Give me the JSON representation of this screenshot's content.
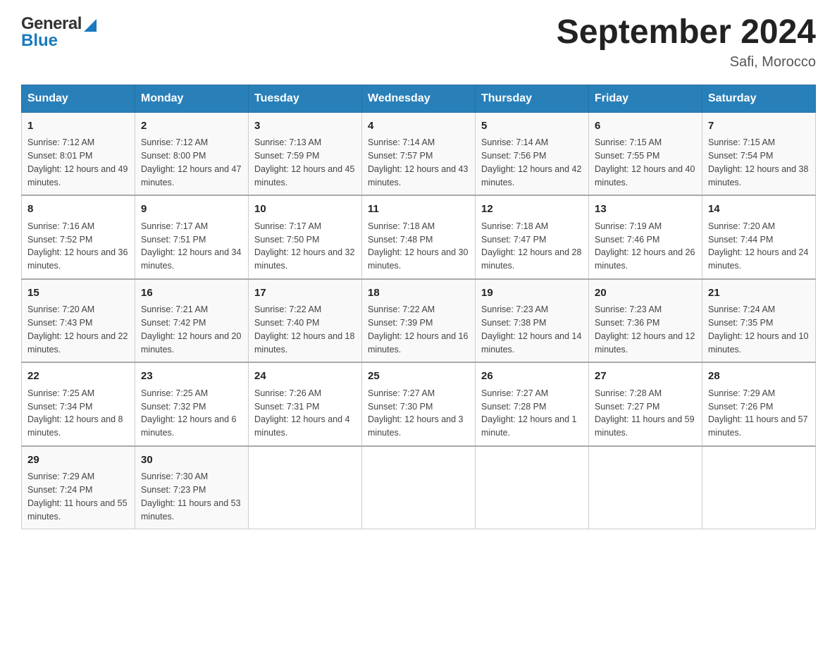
{
  "header": {
    "logo_general": "General",
    "logo_blue": "Blue",
    "calendar_title": "September 2024",
    "calendar_subtitle": "Safi, Morocco"
  },
  "columns": [
    "Sunday",
    "Monday",
    "Tuesday",
    "Wednesday",
    "Thursday",
    "Friday",
    "Saturday"
  ],
  "weeks": [
    [
      {
        "day": "1",
        "sunrise": "7:12 AM",
        "sunset": "8:01 PM",
        "daylight": "12 hours and 49 minutes."
      },
      {
        "day": "2",
        "sunrise": "7:12 AM",
        "sunset": "8:00 PM",
        "daylight": "12 hours and 47 minutes."
      },
      {
        "day": "3",
        "sunrise": "7:13 AM",
        "sunset": "7:59 PM",
        "daylight": "12 hours and 45 minutes."
      },
      {
        "day": "4",
        "sunrise": "7:14 AM",
        "sunset": "7:57 PM",
        "daylight": "12 hours and 43 minutes."
      },
      {
        "day": "5",
        "sunrise": "7:14 AM",
        "sunset": "7:56 PM",
        "daylight": "12 hours and 42 minutes."
      },
      {
        "day": "6",
        "sunrise": "7:15 AM",
        "sunset": "7:55 PM",
        "daylight": "12 hours and 40 minutes."
      },
      {
        "day": "7",
        "sunrise": "7:15 AM",
        "sunset": "7:54 PM",
        "daylight": "12 hours and 38 minutes."
      }
    ],
    [
      {
        "day": "8",
        "sunrise": "7:16 AM",
        "sunset": "7:52 PM",
        "daylight": "12 hours and 36 minutes."
      },
      {
        "day": "9",
        "sunrise": "7:17 AM",
        "sunset": "7:51 PM",
        "daylight": "12 hours and 34 minutes."
      },
      {
        "day": "10",
        "sunrise": "7:17 AM",
        "sunset": "7:50 PM",
        "daylight": "12 hours and 32 minutes."
      },
      {
        "day": "11",
        "sunrise": "7:18 AM",
        "sunset": "7:48 PM",
        "daylight": "12 hours and 30 minutes."
      },
      {
        "day": "12",
        "sunrise": "7:18 AM",
        "sunset": "7:47 PM",
        "daylight": "12 hours and 28 minutes."
      },
      {
        "day": "13",
        "sunrise": "7:19 AM",
        "sunset": "7:46 PM",
        "daylight": "12 hours and 26 minutes."
      },
      {
        "day": "14",
        "sunrise": "7:20 AM",
        "sunset": "7:44 PM",
        "daylight": "12 hours and 24 minutes."
      }
    ],
    [
      {
        "day": "15",
        "sunrise": "7:20 AM",
        "sunset": "7:43 PM",
        "daylight": "12 hours and 22 minutes."
      },
      {
        "day": "16",
        "sunrise": "7:21 AM",
        "sunset": "7:42 PM",
        "daylight": "12 hours and 20 minutes."
      },
      {
        "day": "17",
        "sunrise": "7:22 AM",
        "sunset": "7:40 PM",
        "daylight": "12 hours and 18 minutes."
      },
      {
        "day": "18",
        "sunrise": "7:22 AM",
        "sunset": "7:39 PM",
        "daylight": "12 hours and 16 minutes."
      },
      {
        "day": "19",
        "sunrise": "7:23 AM",
        "sunset": "7:38 PM",
        "daylight": "12 hours and 14 minutes."
      },
      {
        "day": "20",
        "sunrise": "7:23 AM",
        "sunset": "7:36 PM",
        "daylight": "12 hours and 12 minutes."
      },
      {
        "day": "21",
        "sunrise": "7:24 AM",
        "sunset": "7:35 PM",
        "daylight": "12 hours and 10 minutes."
      }
    ],
    [
      {
        "day": "22",
        "sunrise": "7:25 AM",
        "sunset": "7:34 PM",
        "daylight": "12 hours and 8 minutes."
      },
      {
        "day": "23",
        "sunrise": "7:25 AM",
        "sunset": "7:32 PM",
        "daylight": "12 hours and 6 minutes."
      },
      {
        "day": "24",
        "sunrise": "7:26 AM",
        "sunset": "7:31 PM",
        "daylight": "12 hours and 4 minutes."
      },
      {
        "day": "25",
        "sunrise": "7:27 AM",
        "sunset": "7:30 PM",
        "daylight": "12 hours and 3 minutes."
      },
      {
        "day": "26",
        "sunrise": "7:27 AM",
        "sunset": "7:28 PM",
        "daylight": "12 hours and 1 minute."
      },
      {
        "day": "27",
        "sunrise": "7:28 AM",
        "sunset": "7:27 PM",
        "daylight": "11 hours and 59 minutes."
      },
      {
        "day": "28",
        "sunrise": "7:29 AM",
        "sunset": "7:26 PM",
        "daylight": "11 hours and 57 minutes."
      }
    ],
    [
      {
        "day": "29",
        "sunrise": "7:29 AM",
        "sunset": "7:24 PM",
        "daylight": "11 hours and 55 minutes."
      },
      {
        "day": "30",
        "sunrise": "7:30 AM",
        "sunset": "7:23 PM",
        "daylight": "11 hours and 53 minutes."
      },
      null,
      null,
      null,
      null,
      null
    ]
  ]
}
